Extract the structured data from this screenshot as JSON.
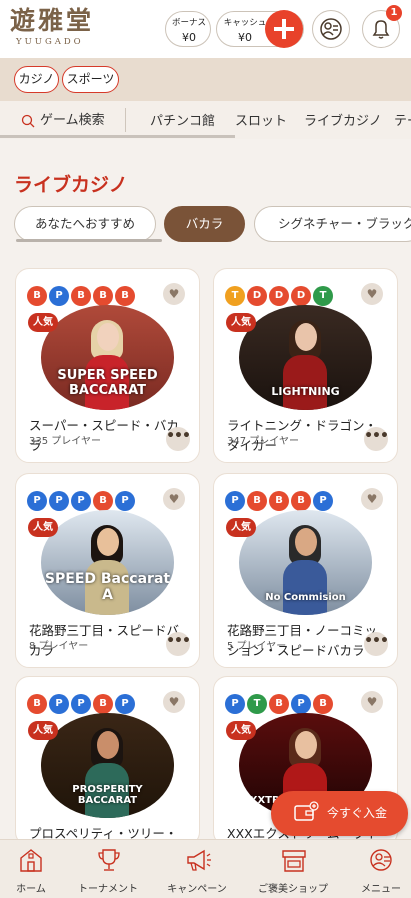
{
  "header": {
    "logo_main": "遊雅堂",
    "logo_sub": "YUUGADO",
    "bonus_label": "ボーナス",
    "bonus_value": "¥0",
    "cash_label": "キャッシュ",
    "cash_value": "¥0",
    "notification_count": "1"
  },
  "categories": [
    "カジノ",
    "スポーツ"
  ],
  "nav": {
    "search_label": "ゲーム検索",
    "items": [
      "パチンコ館",
      "スロット",
      "ライブカジノ",
      "テー"
    ]
  },
  "section_title": "ライブカジノ",
  "filters": [
    "あなたへおすすめ",
    "バカラ",
    "シグネチャー・ブラックジャ"
  ],
  "popular_label": "人気",
  "colors": {
    "brand_red": "#c8311f",
    "accent_orange": "#e8422a",
    "selected_brown": "#7a5338"
  },
  "games": [
    {
      "title": "スーパー・スピード・バカラ",
      "players": "335 プレイヤー",
      "logo": "SUPER SPEED BACCARAT",
      "dots": [
        {
          "t": "B",
          "c": "#e54b2f"
        },
        {
          "t": "P",
          "c": "#2b6fd6"
        },
        {
          "t": "B",
          "c": "#e54b2f"
        },
        {
          "t": "B",
          "c": "#e54b2f"
        },
        {
          "t": "B",
          "c": "#e54b2f"
        }
      ]
    },
    {
      "title": "ライトニング・ドラゴン・タイガー",
      "players": "347 プレイヤー",
      "logo": "LIGHTNING",
      "dots": [
        {
          "t": "T",
          "c": "#f0a020"
        },
        {
          "t": "D",
          "c": "#e54b2f"
        },
        {
          "t": "D",
          "c": "#e54b2f"
        },
        {
          "t": "D",
          "c": "#e54b2f"
        },
        {
          "t": "T",
          "c": "#2f9a4a"
        }
      ]
    },
    {
      "title": "花路野三丁目・スピードバカラ",
      "players": "8 プレイヤー",
      "logo": "SPEED Baccarat A",
      "dots": [
        {
          "t": "P",
          "c": "#2b6fd6"
        },
        {
          "t": "P",
          "c": "#2b6fd6"
        },
        {
          "t": "P",
          "c": "#2b6fd6"
        },
        {
          "t": "B",
          "c": "#e54b2f"
        },
        {
          "t": "P",
          "c": "#2b6fd6"
        }
      ]
    },
    {
      "title": "花路野三丁目・ノーコミッション・スピードバカラ",
      "players": "5 プレイヤー",
      "logo": "No Commision",
      "dots": [
        {
          "t": "P",
          "c": "#2b6fd6"
        },
        {
          "t": "B",
          "c": "#e54b2f"
        },
        {
          "t": "B",
          "c": "#e54b2f"
        },
        {
          "t": "B",
          "c": "#e54b2f"
        },
        {
          "t": "P",
          "c": "#2b6fd6"
        }
      ]
    },
    {
      "title": "プロスペリティ・ツリー・バカラ",
      "players": "",
      "logo": "PROSPERITY BACCARAT",
      "dots": [
        {
          "t": "B",
          "c": "#e54b2f"
        },
        {
          "t": "P",
          "c": "#2b6fd6"
        },
        {
          "t": "P",
          "c": "#2b6fd6"
        },
        {
          "t": "B",
          "c": "#e54b2f"
        },
        {
          "t": "P",
          "c": "#2b6fd6"
        }
      ]
    },
    {
      "title": "XXXエクストリーム・ライトニング・バカラ",
      "players": "",
      "logo": "XXXTREME LIGHTNING",
      "dots": [
        {
          "t": "P",
          "c": "#2b6fd6"
        },
        {
          "t": "T",
          "c": "#2f9a4a"
        },
        {
          "t": "B",
          "c": "#e54b2f"
        },
        {
          "t": "P",
          "c": "#2b6fd6"
        },
        {
          "t": "B",
          "c": "#e54b2f"
        }
      ]
    }
  ],
  "deposit_label": "今すぐ入金",
  "bottom_nav": [
    "ホーム",
    "トーナメント",
    "キャンペーン",
    "ご褒美ショップ",
    "メニュー"
  ]
}
